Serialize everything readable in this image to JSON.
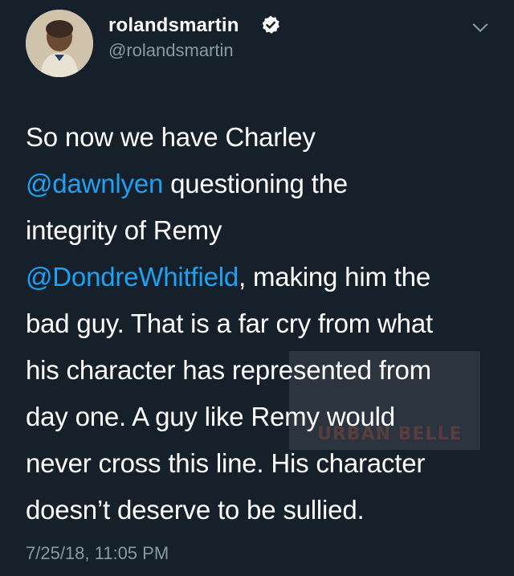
{
  "tweet": {
    "display_name": "rolandsmartin",
    "handle": "@rolandsmartin",
    "verified": true,
    "lines": [
      [
        {
          "t": "So now we have Charley"
        }
      ],
      [
        {
          "t": "@dawnlyen",
          "mention": true
        },
        {
          "t": " questioning the"
        }
      ],
      [
        {
          "t": "integrity of Remy"
        }
      ],
      [
        {
          "t": "@DondreWhitfield",
          "mention": true
        },
        {
          "t": ", making him the"
        }
      ],
      [
        {
          "t": "bad guy. That is a far cry from what"
        }
      ],
      [
        {
          "t": "his character has represented from"
        }
      ],
      [
        {
          "t": "day one. A guy like Remy would"
        }
      ],
      [
        {
          "t": "never cross this line. His character"
        }
      ],
      [
        {
          "t": "doesn’t deserve to be sullied."
        }
      ]
    ],
    "timestamp": "7/25/18, 11:05 PM"
  },
  "watermark": {
    "text": "URBAN BELLE"
  },
  "colors": {
    "background": "#15202b",
    "text": "#ffffff",
    "secondary": "#8899a6",
    "mention": "#1da1f2"
  },
  "icons": [
    "verified-badge-icon",
    "chevron-down-icon"
  ]
}
